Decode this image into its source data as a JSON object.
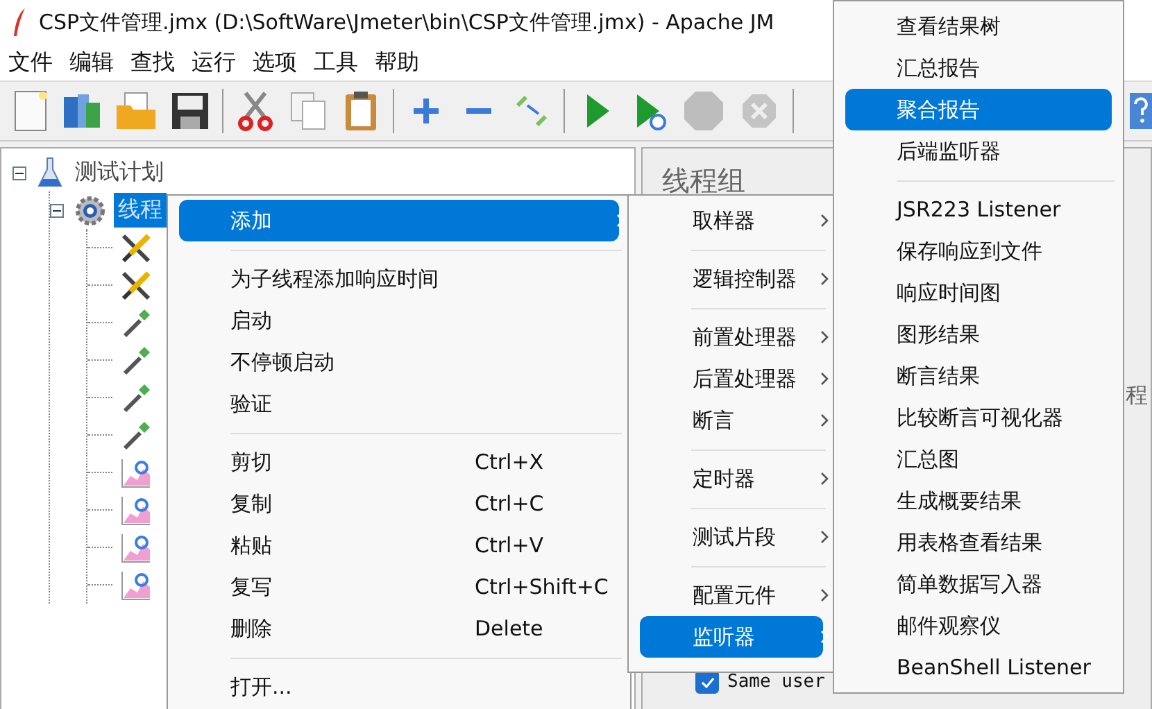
{
  "window": {
    "title": "CSP文件管理.jmx (D:\\SoftWare\\Jmeter\\bin\\CSP文件管理.jmx) - Apache JM"
  },
  "menubar": [
    "文件",
    "编辑",
    "查找",
    "运行",
    "选项",
    "工具",
    "帮助"
  ],
  "tree": [
    {
      "label": "测试计划",
      "kind": "plan",
      "expanded": true,
      "selected": false,
      "children": [
        {
          "label": "线程",
          "kind": "thread",
          "expanded": true,
          "selected": true,
          "children": [
            {
              "kind": "config"
            },
            {
              "kind": "config"
            },
            {
              "kind": "sampler"
            },
            {
              "kind": "sampler"
            },
            {
              "kind": "sampler"
            },
            {
              "kind": "sampler"
            },
            {
              "kind": "listener"
            },
            {
              "kind": "listener"
            },
            {
              "kind": "listener"
            },
            {
              "kind": "listener"
            }
          ]
        }
      ]
    }
  ],
  "panel": {
    "title": "线程组",
    "side_label": "程",
    "checkbox": {
      "label": "Same user",
      "checked": true
    }
  },
  "context_menu": [
    {
      "kind": "item",
      "label": "添加",
      "submenu": true,
      "selected": true
    },
    {
      "kind": "separator"
    },
    {
      "kind": "item",
      "label": "为子线程添加响应时间",
      "submenu": false,
      "selected": false
    },
    {
      "kind": "item",
      "label": "启动",
      "submenu": false,
      "selected": false
    },
    {
      "kind": "item",
      "label": "不停顿启动",
      "submenu": false,
      "selected": false
    },
    {
      "kind": "item",
      "label": "验证",
      "submenu": false,
      "selected": false
    },
    {
      "kind": "separator"
    },
    {
      "kind": "item",
      "label": "剪切",
      "shortcut": "Ctrl+X",
      "submenu": false,
      "selected": false
    },
    {
      "kind": "item",
      "label": "复制",
      "shortcut": "Ctrl+C",
      "submenu": false,
      "selected": false
    },
    {
      "kind": "item",
      "label": "粘贴",
      "shortcut": "Ctrl+V",
      "submenu": false,
      "selected": false
    },
    {
      "kind": "item",
      "label": "复写",
      "shortcut": "Ctrl+Shift+C",
      "submenu": false,
      "selected": false
    },
    {
      "kind": "item",
      "label": "删除",
      "shortcut": "Delete",
      "submenu": false,
      "selected": false
    },
    {
      "kind": "separator"
    },
    {
      "kind": "item",
      "label": "打开...",
      "submenu": false,
      "selected": false
    }
  ],
  "add_submenu": [
    {
      "kind": "item",
      "label": "取样器",
      "submenu": true,
      "selected": false
    },
    {
      "kind": "separator"
    },
    {
      "kind": "item",
      "label": "逻辑控制器",
      "submenu": true,
      "selected": false
    },
    {
      "kind": "separator"
    },
    {
      "kind": "item",
      "label": "前置处理器",
      "submenu": true,
      "selected": false
    },
    {
      "kind": "item",
      "label": "后置处理器",
      "submenu": true,
      "selected": false
    },
    {
      "kind": "item",
      "label": "断言",
      "submenu": true,
      "selected": false
    },
    {
      "kind": "separator"
    },
    {
      "kind": "item",
      "label": "定时器",
      "submenu": true,
      "selected": false
    },
    {
      "kind": "separator"
    },
    {
      "kind": "item",
      "label": "测试片段",
      "submenu": true,
      "selected": false
    },
    {
      "kind": "separator"
    },
    {
      "kind": "item",
      "label": "配置元件",
      "submenu": true,
      "selected": false
    },
    {
      "kind": "item",
      "label": "监听器",
      "submenu": true,
      "selected": true
    }
  ],
  "listener_submenu": [
    {
      "kind": "item",
      "label": "查看结果树",
      "submenu": false,
      "selected": false
    },
    {
      "kind": "item",
      "label": "汇总报告",
      "submenu": false,
      "selected": false
    },
    {
      "kind": "item",
      "label": "聚合报告",
      "submenu": false,
      "selected": true
    },
    {
      "kind": "item",
      "label": "后端监听器",
      "submenu": false,
      "selected": false
    },
    {
      "kind": "separator"
    },
    {
      "kind": "item",
      "label": "JSR223 Listener",
      "submenu": false,
      "selected": false
    },
    {
      "kind": "item",
      "label": "保存响应到文件",
      "submenu": false,
      "selected": false
    },
    {
      "kind": "item",
      "label": "响应时间图",
      "submenu": false,
      "selected": false
    },
    {
      "kind": "item",
      "label": "图形结果",
      "submenu": false,
      "selected": false
    },
    {
      "kind": "item",
      "label": "断言结果",
      "submenu": false,
      "selected": false
    },
    {
      "kind": "item",
      "label": "比较断言可视化器",
      "submenu": false,
      "selected": false
    },
    {
      "kind": "item",
      "label": "汇总图",
      "submenu": false,
      "selected": false
    },
    {
      "kind": "item",
      "label": "生成概要结果",
      "submenu": false,
      "selected": false
    },
    {
      "kind": "item",
      "label": "用表格查看结果",
      "submenu": false,
      "selected": false
    },
    {
      "kind": "item",
      "label": "简单数据写入器",
      "submenu": false,
      "selected": false
    },
    {
      "kind": "item",
      "label": "邮件观察仪",
      "submenu": false,
      "selected": false
    },
    {
      "kind": "item",
      "label": "BeanShell Listener",
      "submenu": false,
      "selected": false
    }
  ]
}
